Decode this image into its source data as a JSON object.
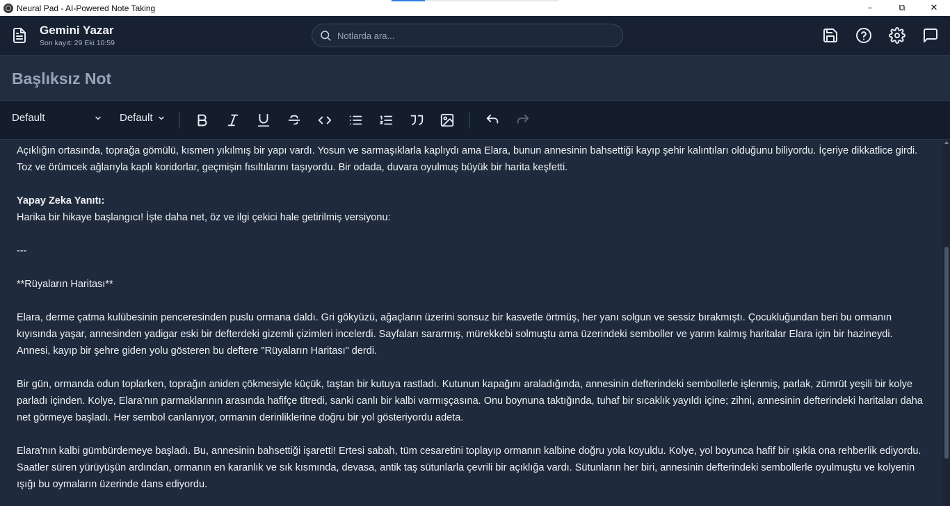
{
  "window": {
    "title": "Neural Pad - AI-Powered Note Taking",
    "minimize": "–",
    "maximize": "⧉",
    "close": "✕"
  },
  "header": {
    "app_name": "Gemini Yazar",
    "last_saved": "Son kayıt: 29 Eki 10:59",
    "search_placeholder": "Notlarda ara...",
    "icons": [
      "document-icon",
      "search-icon",
      "save-icon",
      "help-icon",
      "settings-icon",
      "chat-icon"
    ]
  },
  "note": {
    "title": "Başlıksız Not"
  },
  "toolbar": {
    "font_family": "Default",
    "font_size": "Default",
    "buttons": [
      "bold",
      "italic",
      "underline",
      "strikethrough",
      "code",
      "bullet-list",
      "ordered-list",
      "quote",
      "image",
      "undo",
      "redo"
    ]
  },
  "content": {
    "p1": "Açıklığın ortasında, toprağa gömülü, kısmen yıkılmış bir yapı vardı. Yosun ve sarmaşıklarla kaplıydı ama Elara, bunun annesinin bahsettiği kayıp şehir kalıntıları olduğunu biliyordu. İçeriye dikkatlice girdi. Toz ve örümcek ağlarıyla kaplı koridorlar, geçmişin fısıltılarını taşıyordu. Bir odada, duvara oyulmuş büyük bir harita keşfetti.",
    "ai_heading": "Yapay Zeka Yanıtı:",
    "ai_intro": "Harika bir hikaye başlangıcı! İşte daha net, öz ve ilgi çekici hale getirilmiş versiyonu:",
    "divider": "---",
    "story_title": "**Rüyaların Haritası**",
    "p2": "Elara, derme çatma kulübesinin penceresinden puslu ormana daldı. Gri gökyüzü, ağaçların üzerini sonsuz bir kasvetle örtmüş, her yanı solgun ve sessiz bırakmıştı. Çocukluğundan beri bu ormanın kıyısında yaşar, annesinden yadigar eski bir defterdeki gizemli çizimleri incelerdi. Sayfaları sararmış, mürekkebi solmuştu ama üzerindeki semboller ve yarım kalmış haritalar Elara için bir hazineydi. Annesi, kayıp bir şehre giden yolu gösteren bu deftere \"Rüyaların Haritası\" derdi.",
    "p3": "Bir gün, ormanda odun toplarken, toprağın aniden çökmesiyle küçük, taştan bir kutuya rastladı. Kutunun kapağını araladığında, annesinin defterindeki sembollerle işlenmiş, parlak, zümrüt yeşili bir kolye parladı içinden. Kolye, Elara'nın parmaklarının arasında hafifçe titredi, sanki canlı bir kalbi varmışçasına. Onu boynuna taktığında, tuhaf bir sıcaklık yayıldı içine; zihni, annesinin defterindeki haritaları daha net görmeye başladı. Her sembol canlanıyor, ormanın derinliklerine doğru bir yol gösteriyordu adeta.",
    "p4": "Elara'nın kalbi gümbürdemeye başladı. Bu, annesinin bahsettiği işaretti! Ertesi sabah, tüm cesaretini toplayıp ormanın kalbine doğru yola koyuldu. Kolye, yol boyunca hafif bir ışıkla ona rehberlik ediyordu. Saatler süren yürüyüşün ardından, ormanın en karanlık ve sık kısmında, devasa, antik taş sütunlarla çevrili bir açıklığa vardı. Sütunların her biri, annesinin defterindeki sembollerle oyulmuştu ve kolyenin ışığı bu oymaların üzerinde dans ediyordu."
  },
  "colors": {
    "header_bg": "#172132",
    "editor_bg": "#1f2a3c",
    "toolbar_bg": "#141d2c",
    "title_band_bg": "#222d40",
    "note_title": "#97a3b7"
  }
}
